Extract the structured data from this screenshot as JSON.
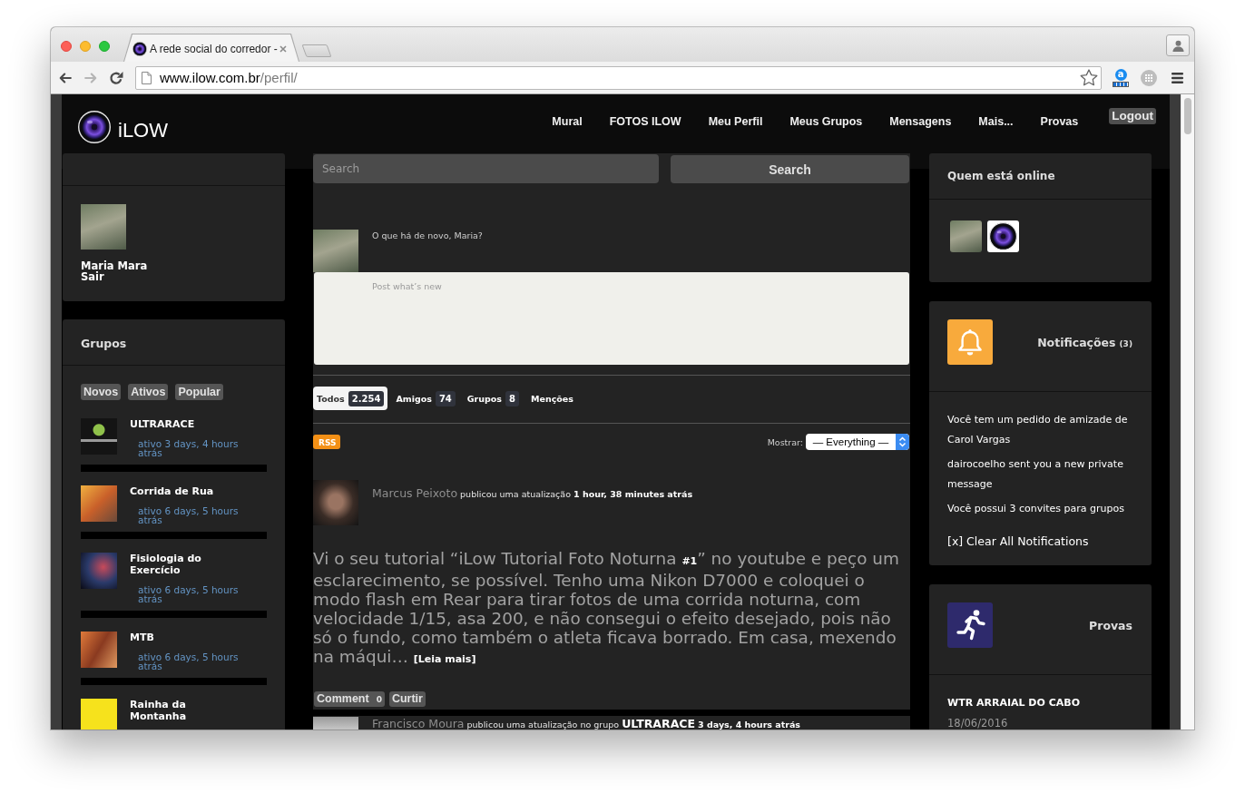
{
  "browser": {
    "tab_title": "A rede social do corredor -",
    "url": "www.ilow.com.br/perfil/",
    "forward_disabled": true,
    "extension_badge": "a"
  },
  "header": {
    "logo_text": "iLOW",
    "nav": [
      {
        "label": "Mural"
      },
      {
        "label": "FOTOS ILOW"
      },
      {
        "label": "Meu Perfil"
      },
      {
        "label": "Meus Grupos"
      },
      {
        "label": "Mensagens"
      },
      {
        "label": "Mais..."
      },
      {
        "label": "Provas"
      }
    ],
    "logout": "Logout"
  },
  "profile": {
    "name": "Maria Mara",
    "logout_link": "Sair"
  },
  "groups": {
    "title": "Grupos",
    "filters": [
      "Novos",
      "Ativos",
      "Popular"
    ],
    "items": [
      {
        "name": "ULTRARACE",
        "activity": "ativo 3 days, 4 hours atrás"
      },
      {
        "name": "Corrida de Rua",
        "activity": "ativo 6 days, 5 hours atrás"
      },
      {
        "name": "Fisiologia do Exercício",
        "activity": "ativo 6 days, 5 hours atrás"
      },
      {
        "name": "MTB",
        "activity": "ativo 6 days, 5 hours atrás"
      },
      {
        "name": "Rainha da Montanha"
      }
    ]
  },
  "search": {
    "placeholder": "Search",
    "button": "Search"
  },
  "whats_new": {
    "prompt": "O que há de novo, Maria?",
    "placeholder": "Post what’s new"
  },
  "activity_tabs": [
    {
      "label": "Todos",
      "count": "2.254",
      "selected": true
    },
    {
      "label": "Amigos",
      "count": "74",
      "selected": false
    },
    {
      "label": "Grupos",
      "count": "8",
      "selected": false
    },
    {
      "label": "Menções",
      "selected": false
    }
  ],
  "feed_filter": {
    "rss": "RSS",
    "label": "Mostrar:",
    "value": "— Everything —"
  },
  "activities": [
    {
      "author": "Marcus Peixoto",
      "action": "publicou uma atualização",
      "time": "1 hour, 38 minutes atrás",
      "content": "Vi o seu tutorial “iLow Tutorial Foto Noturna **#1**” no youtube e peço um esclarecimento, se possível. Tenho uma Nikon D7000 e coloquei o modo flash em Rear para tirar fotos de uma corrida noturna, com velocidade 1/15, asa 200, e não consegui o efeito desejado, pois não só o fundo, como também o atleta ficava borrado. Em casa, mexendo na máqui…",
      "read_more": "[Leia mais]",
      "comment_button": "Comment",
      "comment_count": "0",
      "like_button": "Curtir"
    },
    {
      "author": "Francisco Moura",
      "action": "publicou uma atualização no grupo",
      "group": "ULTRARACE",
      "time": "3 days, 4 hours atrás"
    }
  ],
  "online": {
    "title": "Quem está online",
    "members": [
      {
        "kind": "photo"
      },
      {
        "kind": "logo"
      }
    ]
  },
  "notifications": {
    "title": "Notificações",
    "count": "(3)",
    "items": [
      "Você tem um pedido de amizade de Carol Vargas",
      "dairocoelho sent you a new private message",
      "Você possui 3 convites para grupos"
    ],
    "clear_link": "[x] Clear All Notifications"
  },
  "races": {
    "title": "Provas",
    "items": [
      {
        "name": "WTR ARRAIAL DO CABO",
        "date": "18/06/2016"
      }
    ]
  }
}
